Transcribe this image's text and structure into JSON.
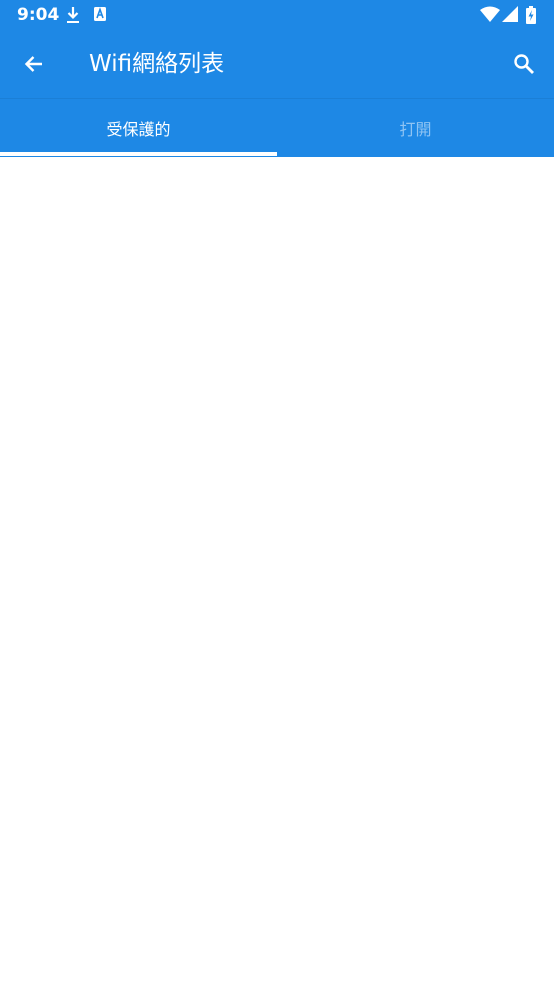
{
  "status_bar": {
    "time": "9:04",
    "left_icons": [
      "download-icon",
      "a-notification-icon"
    ],
    "right_icons": [
      "wifi-icon",
      "cell-signal-icon",
      "battery-icon"
    ]
  },
  "app_bar": {
    "title": "Wifi網絡列表",
    "back_icon": "arrow-back-icon",
    "search_icon": "search-icon"
  },
  "tabs": [
    {
      "label": "受保護的",
      "selected": true
    },
    {
      "label": "打開",
      "selected": false
    }
  ],
  "colors": {
    "primary": "#1e88e5",
    "tab_active_text": "#ffffff",
    "tab_inactive_text": "#8fc4f3",
    "indicator": "#ffffff",
    "background": "#ffffff"
  }
}
